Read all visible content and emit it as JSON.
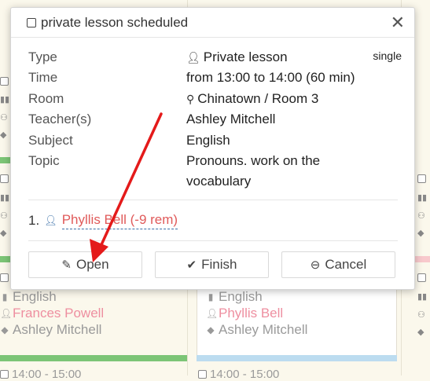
{
  "modal": {
    "title": "private lesson scheduled",
    "close_symbol": "✕",
    "badge": "single",
    "fields": {
      "type_label": "Type",
      "type_value": "Private lesson",
      "time_label": "Time",
      "time_value": "from 13:00 to 14:00 (60 min)",
      "room_label": "Room",
      "room_value": "Chinatown / Room 3",
      "teacher_label": "Teacher(s)",
      "teacher_value": "Ashley Mitchell",
      "subject_label": "Subject",
      "subject_value": "English",
      "topic_label": "Topic",
      "topic_line1": "Pronouns. work on the",
      "topic_line2": "vocabulary"
    },
    "student": {
      "number": "1.",
      "name": "Phyllis Bell (-9 rem)"
    },
    "buttons": {
      "open": "Open",
      "finish": "Finish",
      "cancel": "Cancel"
    }
  },
  "background": {
    "left_card": {
      "subject": "English",
      "student": "Frances Powell",
      "teacher": "Ashley Mitchell",
      "next_time": "14:00 - 15:00"
    },
    "middle_card": {
      "subject": "English",
      "student": "Phyllis Bell",
      "teacher": "Ashley Mitchell",
      "next_time": "14:00 - 15:00"
    }
  },
  "colors": {
    "link_blue": "#3a6fa8",
    "student_red": "#e05a5a",
    "annotation_arrow": "#e41a1a",
    "green_strip": "#7cc576",
    "blue_strip": "#bcdcf0",
    "pink_strip": "#f8c9cc"
  }
}
